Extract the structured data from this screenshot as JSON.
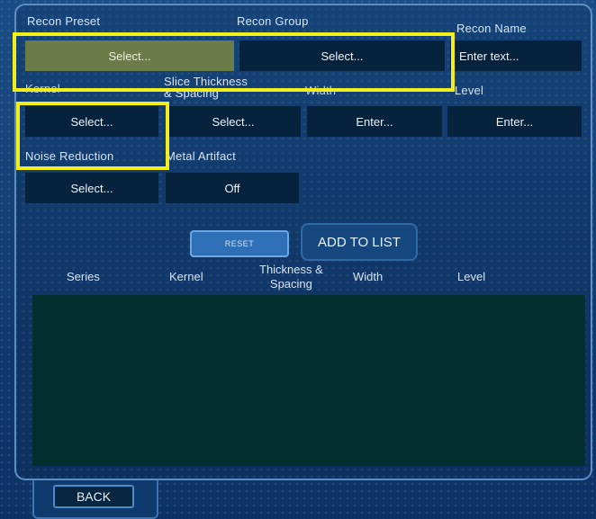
{
  "labels": {
    "recon_preset": "Recon Preset",
    "recon_group": "Recon Group",
    "recon_name": "Recon Name",
    "kernel": "Kernel",
    "slice_thickness_1": "Slice Thickness",
    "slice_thickness_2": "& Spacing",
    "width": "Width",
    "level": "Level",
    "noise_reduction": "Noise Reduction",
    "metal_artifact": "Metal Artifact"
  },
  "fields": {
    "recon_preset": "Select...",
    "recon_group": "Select...",
    "recon_name_placeholder": "Enter text...",
    "kernel": "Select...",
    "slice_thickness": "Select...",
    "width": "Enter...",
    "level": "Enter...",
    "noise_reduction": "Select...",
    "metal_artifact": "Off"
  },
  "buttons": {
    "reset": "RESET",
    "add_to_list": "ADD TO LIST",
    "back": "BACK"
  },
  "list": {
    "columns": {
      "series": "Series",
      "kernel": "Kernel",
      "thickness_1": "Thickness &",
      "thickness_2": "Spacing",
      "width": "Width",
      "level": "Level"
    },
    "rows": []
  },
  "colors": {
    "highlight": "#f2ee1b",
    "selected_field": "#6b7c48",
    "field": "#06223c",
    "list_background": "#022f2e"
  }
}
